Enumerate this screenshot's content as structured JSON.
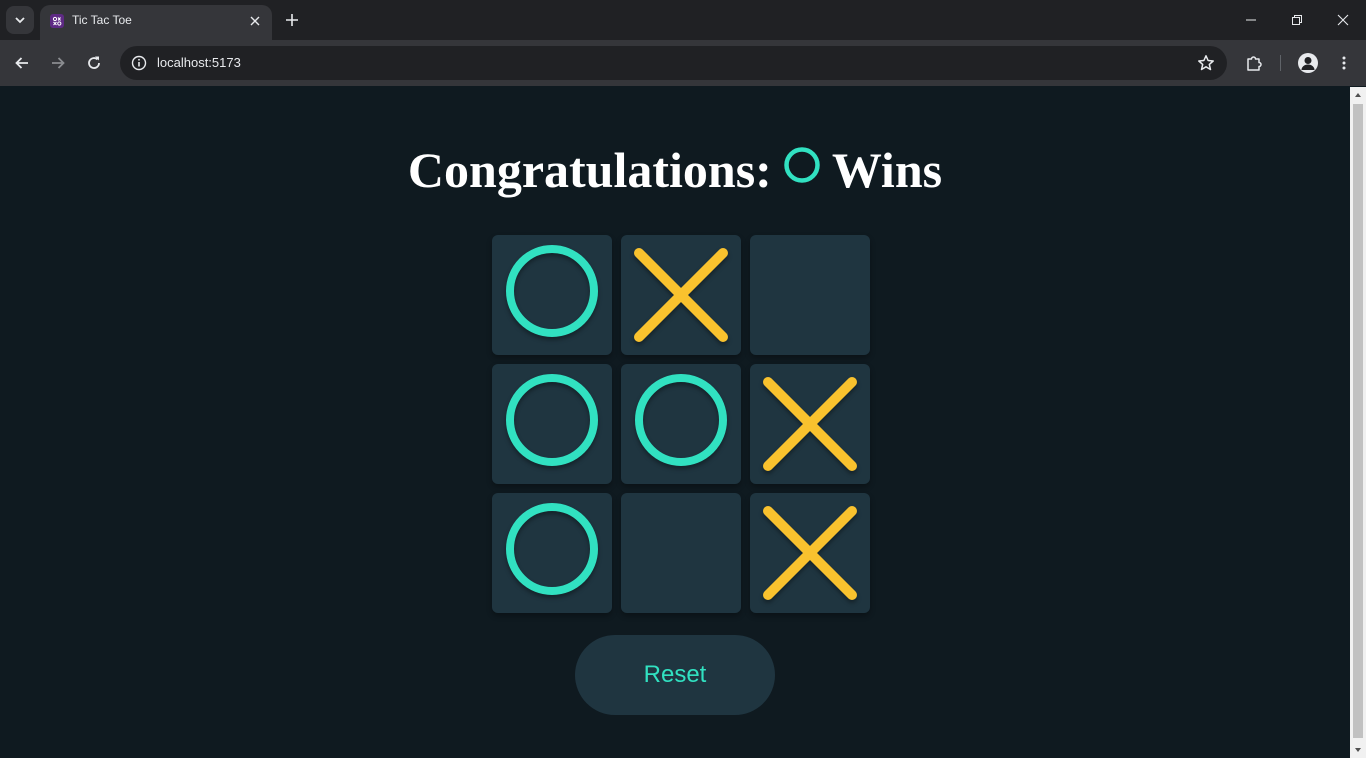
{
  "browser": {
    "tab_title": "Tic Tac Toe",
    "url": "localhost:5173"
  },
  "game": {
    "title_prefix": "Congratulations:",
    "title_suffix": "Wins",
    "winner": "O",
    "board": [
      "O",
      "X",
      "",
      "O",
      "O",
      "X",
      "O",
      "",
      "X"
    ],
    "reset_label": "Reset"
  },
  "colors": {
    "background": "#0f1a20",
    "cell": "#1f3540",
    "o_color": "#31e1c1",
    "x_color": "#f9c22e",
    "title": "#ffffff"
  },
  "icons": {
    "o_mark": "circle-icon",
    "x_mark": "cross-icon"
  }
}
